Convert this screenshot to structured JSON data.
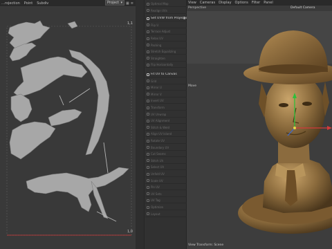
{
  "uv_editor": {
    "menu": [
      "…rojection",
      "Point",
      "Subdiv"
    ],
    "dropdown_value": "Project",
    "dropdown_arrow": "chevron-down-icon",
    "top_corner": "1,1",
    "bottom_corner": "1,0"
  },
  "command_panel": {
    "items": [
      {
        "label": "Optimal Map",
        "active": false
      },
      {
        "label": "Realign UVs",
        "active": false
      },
      {
        "label": "Set UVW from Projection",
        "active": true,
        "gear": true
      },
      {
        "label": "Flip U",
        "active": false
      },
      {
        "label": "Terrace Adjust",
        "active": false
      },
      {
        "label": "Relax UV",
        "active": false
      },
      {
        "label": "Packing",
        "active": false
      },
      {
        "label": "Stretch Equalizing",
        "active": false
      },
      {
        "label": "Straighten",
        "active": false
      },
      {
        "label": "Flip Horizontally",
        "active": false
      },
      {
        "label": "Fit UV to Canvas",
        "active": true
      },
      {
        "label": "Grid",
        "active": false
      },
      {
        "label": "Mirror U",
        "active": false
      },
      {
        "label": "Mirror V",
        "active": false
      },
      {
        "label": "Invert UV",
        "active": false
      },
      {
        "label": "Transform",
        "active": false
      },
      {
        "label": "UV Unwrap",
        "active": false
      },
      {
        "label": "UV Alignment",
        "active": false
      },
      {
        "label": "Stitch & Weld",
        "active": false
      },
      {
        "label": "Align UV Island",
        "active": false
      },
      {
        "label": "Rotate UV",
        "active": false
      },
      {
        "label": "Boundary UV",
        "active": false
      },
      {
        "label": "Cut Seams",
        "active": false
      },
      {
        "label": "Stitch UV",
        "active": false
      },
      {
        "label": "Select UV",
        "active": false
      },
      {
        "label": "Unfold UV",
        "active": false
      },
      {
        "label": "Scale UV",
        "active": false
      },
      {
        "label": "Pin UV",
        "active": false
      },
      {
        "label": "UV Sets",
        "active": false
      },
      {
        "label": "UV Tag",
        "active": false
      },
      {
        "label": "Optimize",
        "active": false
      },
      {
        "label": "Layout",
        "active": false
      }
    ]
  },
  "viewport": {
    "menu": [
      "View",
      "Cameras",
      "Display",
      "Options",
      "Filter",
      "Panel"
    ],
    "perspective_label": "Perspective",
    "camera_label": "Default Camera",
    "move_label": "Move",
    "footer": "View Transform: Scene",
    "colors": {
      "bronze": "#8a6a3c",
      "bronze_light": "#c9a46a",
      "bronze_dark": "#4a361c"
    }
  }
}
